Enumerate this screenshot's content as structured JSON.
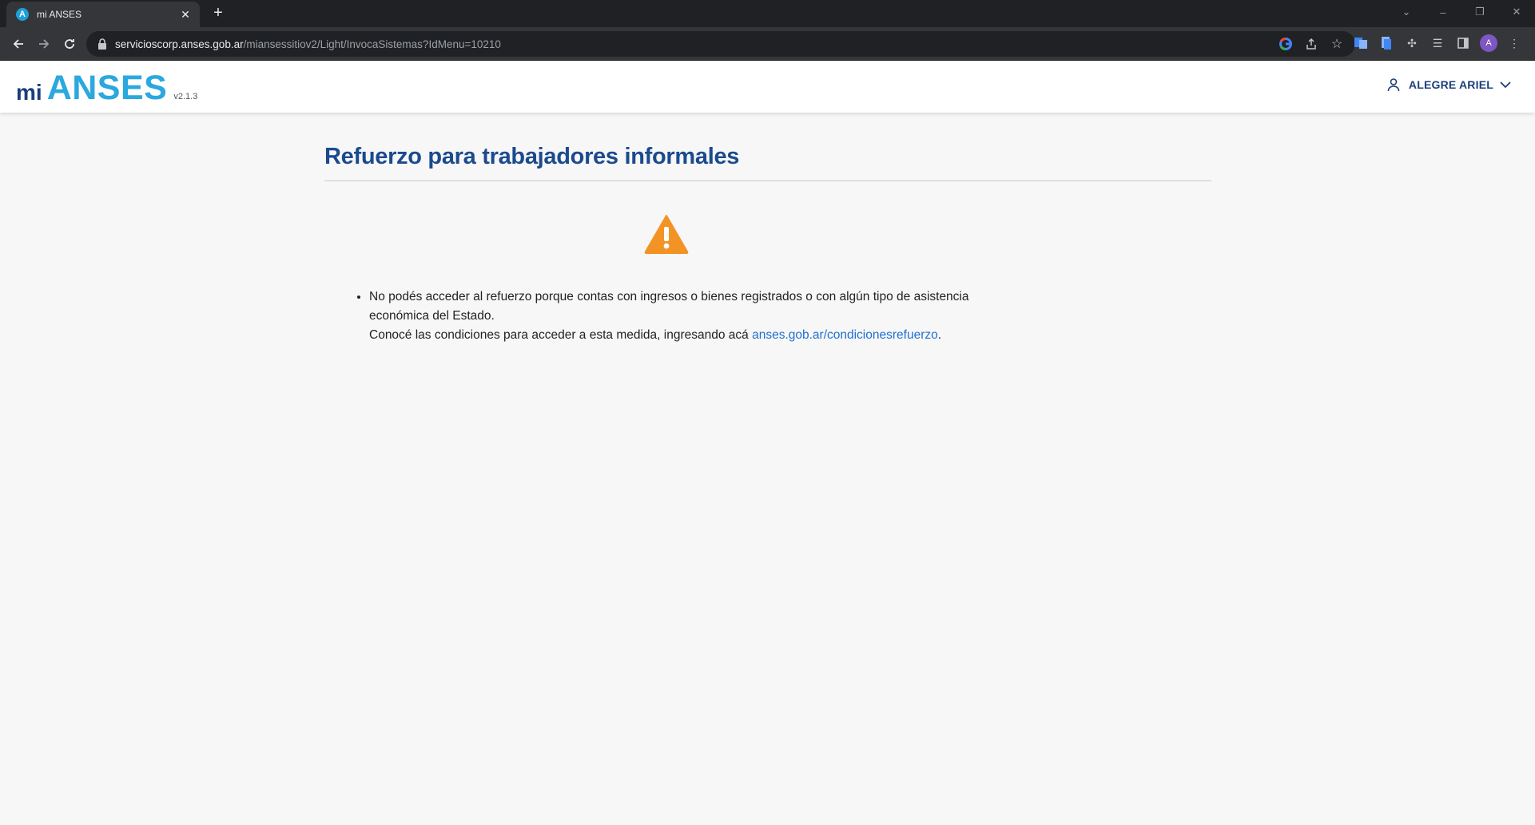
{
  "browser": {
    "tab_title": "mi ANSES",
    "tab_favicon_letter": "A",
    "url_host": "servicioscorp.anses.gob.ar",
    "url_path": "/miansessitiov2/Light/InvocaSistemas?IdMenu=10210",
    "profile_initial": "A"
  },
  "header": {
    "logo_mi": "mi",
    "logo_anses": "ANSES",
    "version": "v2.1.3",
    "user_name": "ALEGRE ARIEL"
  },
  "main": {
    "title": "Refuerzo para trabajadores informales",
    "message_line1": "No podés acceder al refuerzo porque contas con ingresos o bienes registrados o con algún tipo de asistencia económica del Estado.",
    "message_line2_prefix": "Conocé las condiciones para acceder a esta medida, ingresando acá ",
    "message_link": "anses.gob.ar/condicionesrefuerzo",
    "message_line2_suffix": "."
  },
  "colors": {
    "brand_dark": "#1b3d7a",
    "brand_light": "#2ba8de",
    "warning": "#f39325",
    "link": "#1f6fd1"
  }
}
